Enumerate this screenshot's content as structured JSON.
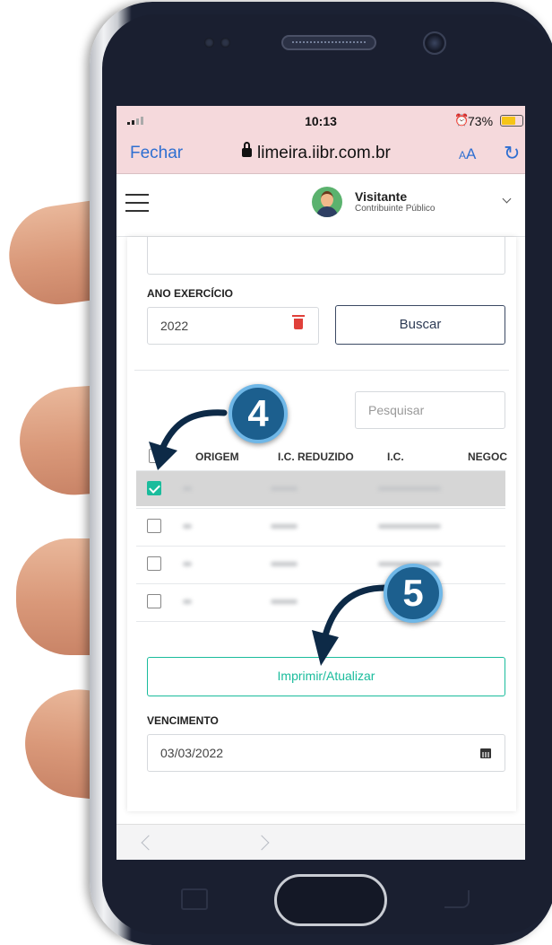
{
  "status_bar": {
    "time": "10:13",
    "battery": "73%"
  },
  "browser": {
    "close_label": "Fechar",
    "url": "limeira.iibr.com.br",
    "text_size_small": "A",
    "text_size_large": "A",
    "reload_icon": "↻"
  },
  "header": {
    "user_name": "Visitante",
    "user_role": "Contribuinte Público"
  },
  "form": {
    "year_label": "ANO EXERCÍCIO",
    "year_value": "2022",
    "search_button": "Buscar",
    "filter_placeholder": "Pesquisar"
  },
  "table": {
    "columns": [
      "ORIGEM",
      "I.C. REDUZIDO",
      "I.C.",
      "NEGOC"
    ],
    "rows": [
      {
        "checked": true
      },
      {
        "checked": false
      },
      {
        "checked": false
      },
      {
        "checked": false
      }
    ]
  },
  "actions": {
    "print_button": "Imprimir/Atualizar"
  },
  "due": {
    "label": "VENCIMENTO",
    "date": "03/03/2022"
  },
  "steps": {
    "step_4": "4",
    "step_5": "5"
  },
  "colors": {
    "accent": "#1abc9c",
    "link": "#2f6fd1",
    "step_marker": "#1c5f8e",
    "browser_bar": "#f5d9dc"
  }
}
